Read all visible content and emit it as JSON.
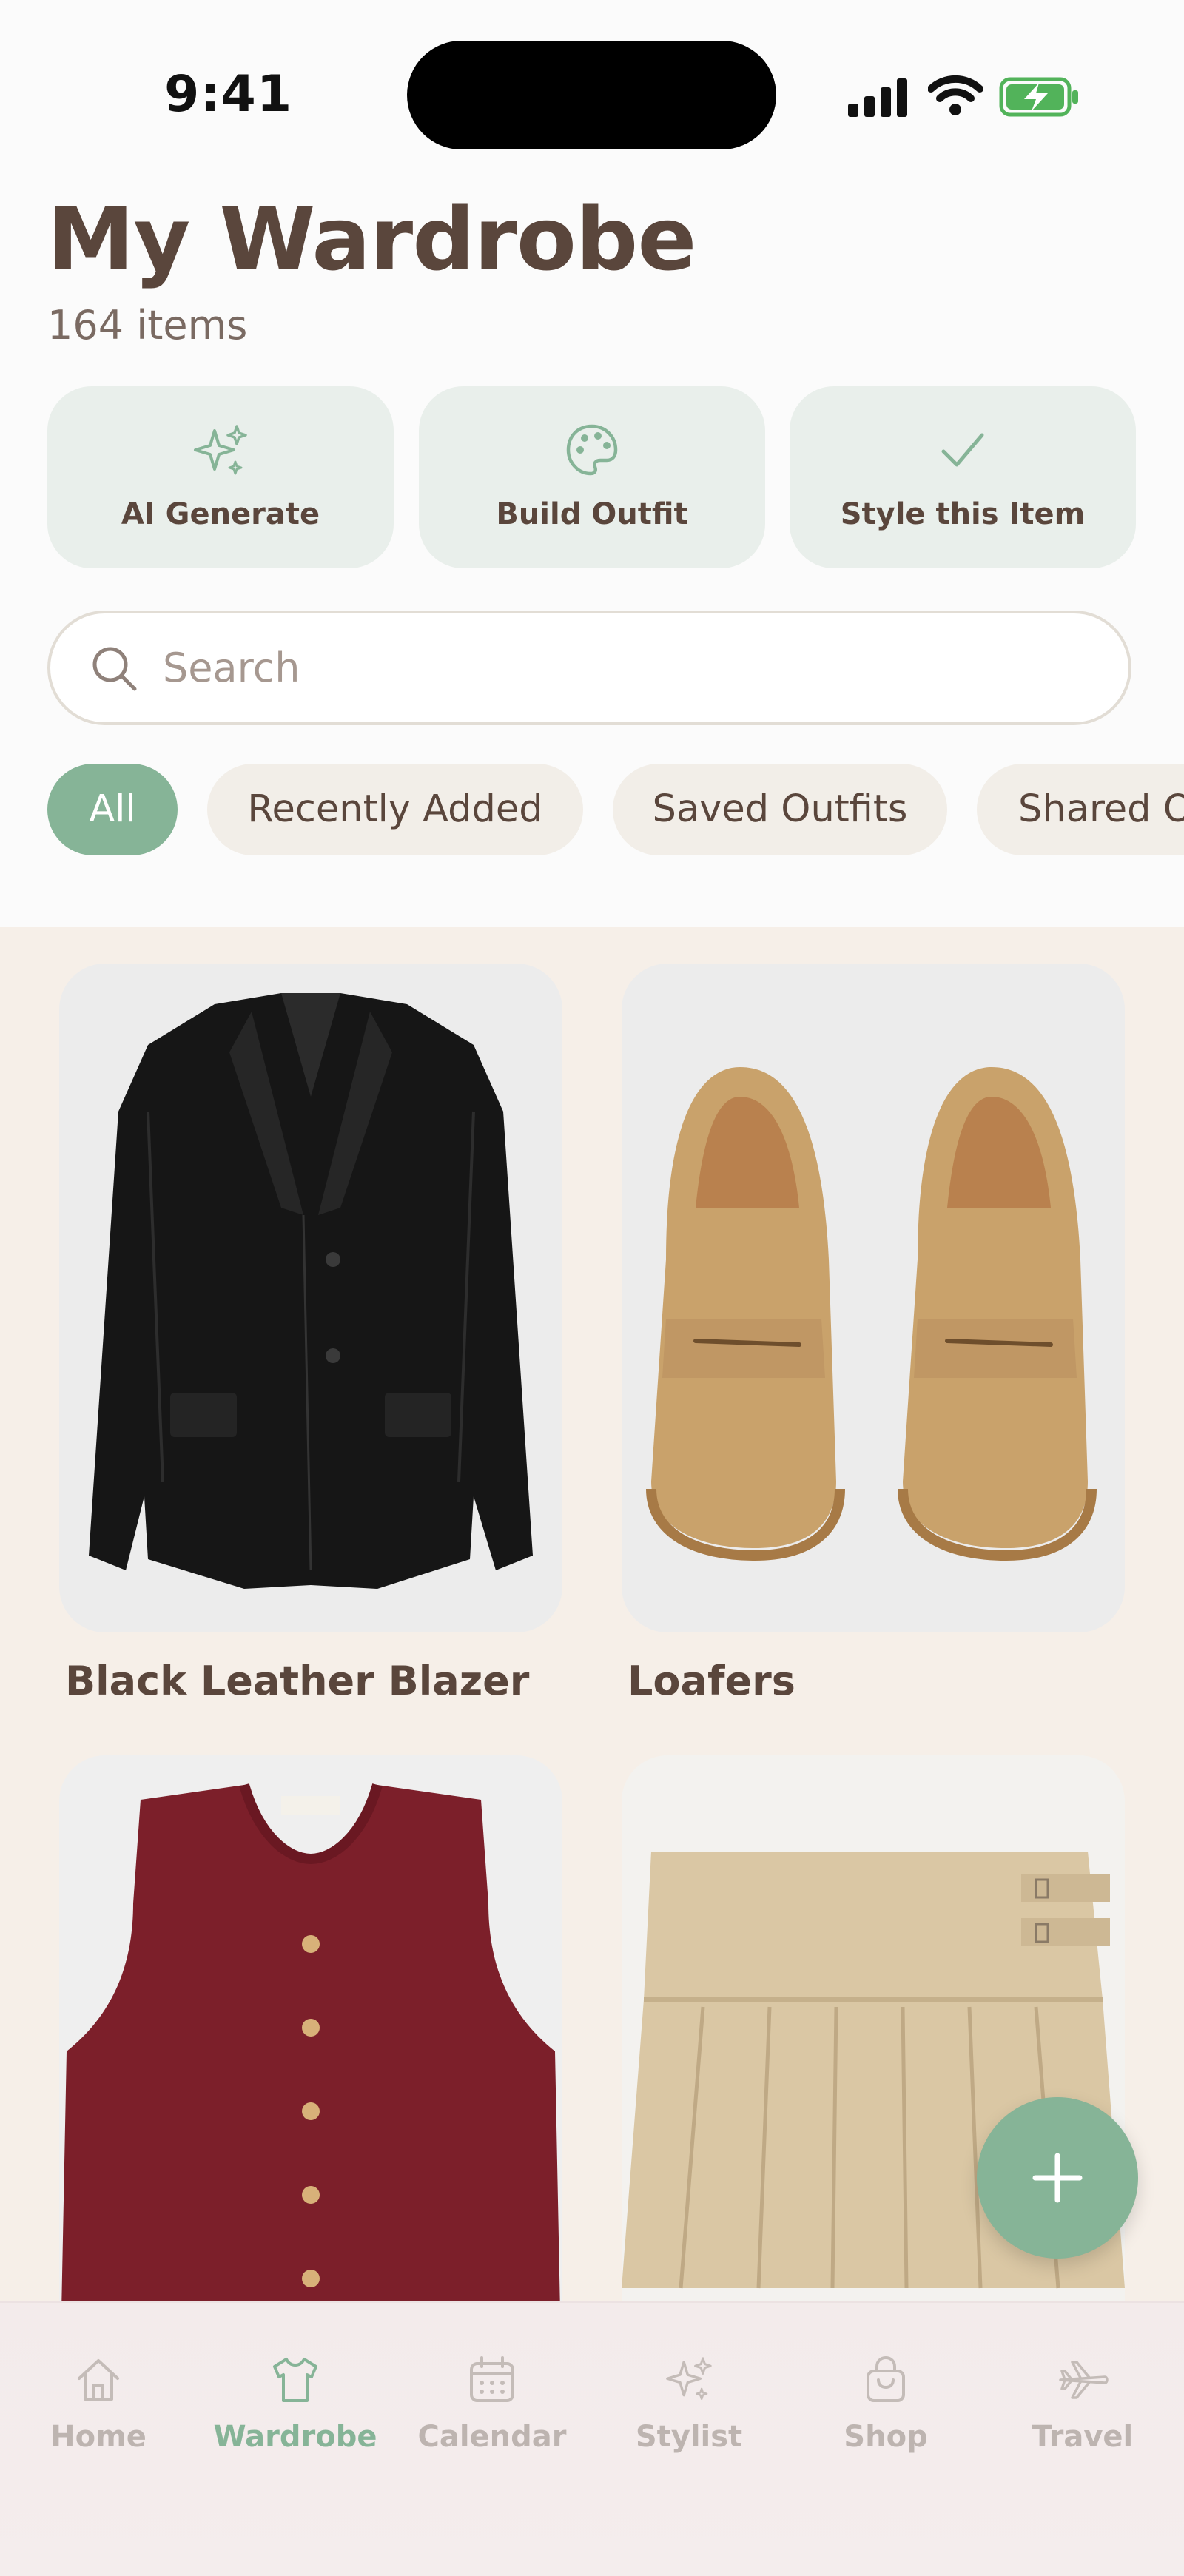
{
  "status_bar": {
    "time": "9:41"
  },
  "header": {
    "title": "My Wardrobe",
    "item_count": "164 items"
  },
  "quick_actions": [
    {
      "label": "AI Generate",
      "icon": "sparkles-icon"
    },
    {
      "label": "Build Outfit",
      "icon": "palette-icon"
    },
    {
      "label": "Style this Item",
      "icon": "checkmark-icon"
    }
  ],
  "search": {
    "placeholder": "Search"
  },
  "filters": [
    {
      "label": "All",
      "active": true
    },
    {
      "label": "Recently Added",
      "active": false
    },
    {
      "label": "Saved Outfits",
      "active": false
    },
    {
      "label": "Shared O",
      "active": false
    }
  ],
  "items": [
    {
      "name": "Black Leather Blazer",
      "image": "black-leather-blazer-image"
    },
    {
      "name": "Loafers",
      "image": "suede-loafers-image"
    },
    {
      "name": "",
      "image": "burgundy-knit-vest-image"
    },
    {
      "name": "",
      "image": "beige-pleated-skirt-image"
    }
  ],
  "tabbar": [
    {
      "label": "Home",
      "icon": "home-icon",
      "active": false
    },
    {
      "label": "Wardrobe",
      "icon": "tshirt-icon",
      "active": true
    },
    {
      "label": "Calendar",
      "icon": "calendar-icon",
      "active": false
    },
    {
      "label": "Stylist",
      "icon": "sparkles-icon",
      "active": false
    },
    {
      "label": "Shop",
      "icon": "shopping-bag-icon",
      "active": false
    },
    {
      "label": "Travel",
      "icon": "airplane-icon",
      "active": false
    }
  ],
  "colors": {
    "accent": "#86b497",
    "text": "#5a463c",
    "chip_bg": "#f2eee8",
    "action_bg": "#e9efeb",
    "grid_bg": "#f6efe8"
  }
}
